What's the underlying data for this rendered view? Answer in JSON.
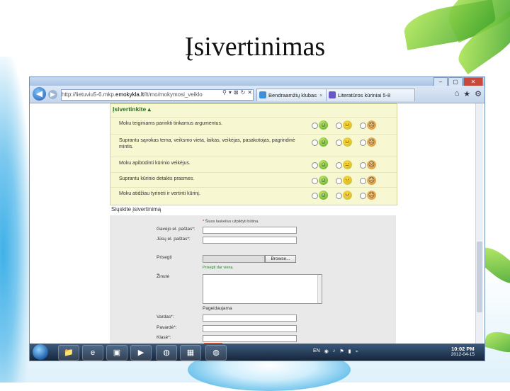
{
  "slide": {
    "title": "Įsivertinimas"
  },
  "browser": {
    "window_buttons": [
      "–",
      "▢",
      "✕"
    ],
    "address": {
      "prefix": "http://lietuviu5-6.mkp.",
      "domain": "emokykla.lt",
      "suffix": "/lt/mo/mokymosi_veiklo"
    },
    "address_icons": [
      "⚲",
      "▾",
      "⊠",
      "↻",
      "✕"
    ],
    "tabs": [
      {
        "label": "Bendraamžių klubas",
        "close": "×"
      },
      {
        "label": "Literatūros kūriniai 5-8",
        "close": ""
      }
    ],
    "toolbar_icons": [
      "⌂",
      "★",
      "⚙"
    ]
  },
  "self_assessment": {
    "title": "Įsivertinkite ▴",
    "items": [
      {
        "text": "Moku teiginiams parinkti tinkamus argumentus."
      },
      {
        "text": "Suprantu sąvokas tema, veiksmo vieta, laikas, veikėjas, pasakotojas, pagrindinė mintis."
      },
      {
        "text": "Moku apibūdinti kūrinio veikėjus."
      },
      {
        "text": "Suprantu kūrinio detalės prasmes."
      },
      {
        "text": "Moku atidžiau tyrinėti ir vertinti kūrinį."
      }
    ],
    "faces": [
      "☺",
      "😐",
      "☹"
    ]
  },
  "review": {
    "title": "Siųskite įsivertinimą",
    "required_note": "Šiuos laukelius užpildyti būtina.",
    "fields": {
      "recipient": "Gavėjo el. paštas*:",
      "your_email": "Jūsų el. paštas*:",
      "attach": "Prisegti",
      "message": "Žinutė",
      "name": "Vardas*:",
      "surname": "Pavardė*:",
      "class": "Klasė*:"
    },
    "browse_label": "Browse...",
    "attach_more": "Prisegti dar vieną",
    "section": "Pageidaujama"
  },
  "taskbar": {
    "icons": [
      "📁",
      "e",
      "▣",
      "▶",
      "◍",
      "▦",
      "◍"
    ],
    "tray": [
      "EN",
      "◉",
      "♪",
      "⚑",
      "▮",
      "⌁"
    ],
    "time": "10:02 PM",
    "date": "2012-04-15"
  }
}
